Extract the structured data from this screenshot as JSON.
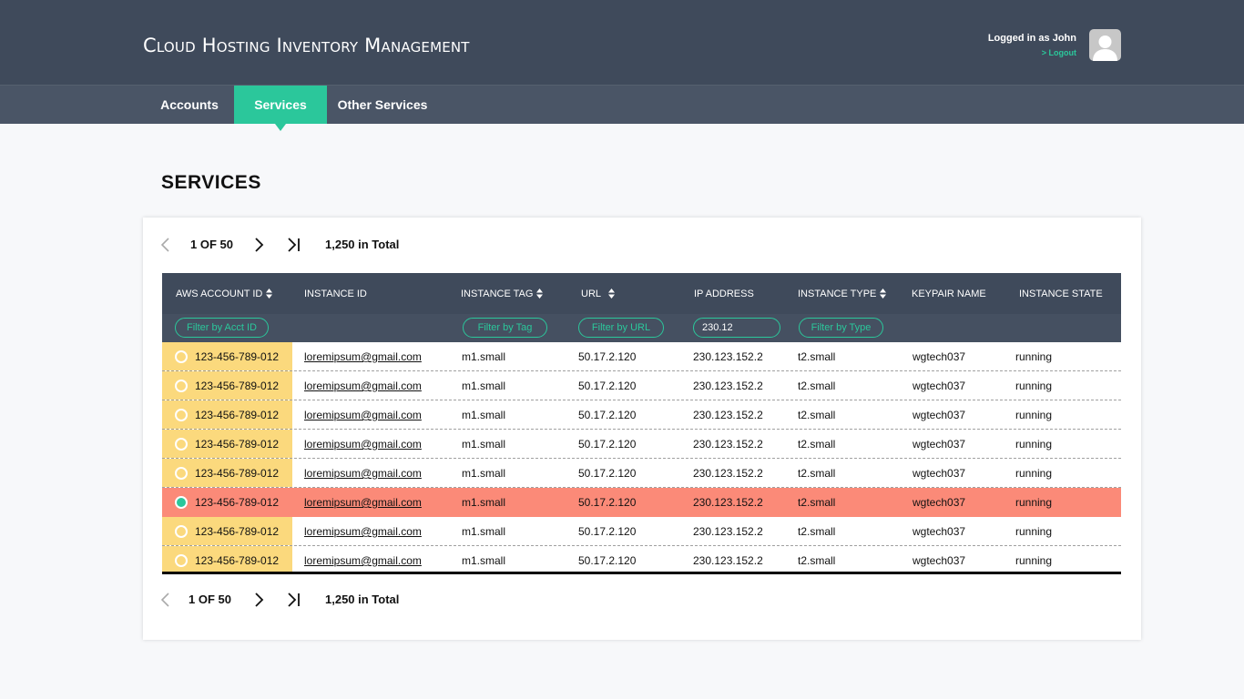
{
  "header": {
    "title": "Cloud Hosting Inventory Management",
    "logged_in": "Logged in as John",
    "logout": "> Logout"
  },
  "nav": {
    "tabs": [
      {
        "label": "Accounts",
        "active": false
      },
      {
        "label": "Services",
        "active": true
      },
      {
        "label": "Other Services",
        "active": false
      }
    ]
  },
  "page_title": "SERVICES",
  "pager": {
    "top_label": "1 OF 50",
    "bottom_label": "1 OF 50",
    "total": "1,250 in Total"
  },
  "table": {
    "columns": [
      {
        "label": "AWS ACCOUNT ID",
        "sortable": true
      },
      {
        "label": "INSTANCE ID",
        "sortable": false
      },
      {
        "label": "INSTANCE TAG",
        "sortable": true
      },
      {
        "label": "URL",
        "sortable": true
      },
      {
        "label": "IP ADDRESS",
        "sortable": false
      },
      {
        "label": "INSTANCE TYPE",
        "sortable": true
      },
      {
        "label": "KEYPAIR NAME",
        "sortable": false
      },
      {
        "label": "INSTANCE STATE",
        "sortable": false
      }
    ],
    "filters": {
      "acct_placeholder": "Filter by Acct ID",
      "tag_placeholder": "Filter by Tag",
      "url_placeholder": "Filter by URL",
      "ip_value": "230.12",
      "type_placeholder": "Filter by Type"
    },
    "rows": [
      {
        "account": "123-456-789-012",
        "instance": "loremipsum@gmail.com",
        "tag": "m1.small",
        "url": "50.17.2.120",
        "ip": "230.123.152.2",
        "type": "t2.small",
        "keypair": "wgtech037",
        "state": "running",
        "selected": false
      },
      {
        "account": "123-456-789-012",
        "instance": "loremipsum@gmail.com",
        "tag": "m1.small",
        "url": "50.17.2.120",
        "ip": "230.123.152.2",
        "type": "t2.small",
        "keypair": "wgtech037",
        "state": "running",
        "selected": false
      },
      {
        "account": "123-456-789-012",
        "instance": "loremipsum@gmail.com",
        "tag": "m1.small",
        "url": "50.17.2.120",
        "ip": "230.123.152.2",
        "type": "t2.small",
        "keypair": "wgtech037",
        "state": "running",
        "selected": false
      },
      {
        "account": "123-456-789-012",
        "instance": "loremipsum@gmail.com",
        "tag": "m1.small",
        "url": "50.17.2.120",
        "ip": "230.123.152.2",
        "type": "t2.small",
        "keypair": "wgtech037",
        "state": "running",
        "selected": false
      },
      {
        "account": "123-456-789-012",
        "instance": "loremipsum@gmail.com",
        "tag": "m1.small",
        "url": "50.17.2.120",
        "ip": "230.123.152.2",
        "type": "t2.small",
        "keypair": "wgtech037",
        "state": "running",
        "selected": false
      },
      {
        "account": "123-456-789-012",
        "instance": "loremipsum@gmail.com",
        "tag": "m1.small",
        "url": "50.17.2.120",
        "ip": "230.123.152.2",
        "type": "t2.small",
        "keypair": "wgtech037",
        "state": "running",
        "selected": true
      },
      {
        "account": "123-456-789-012",
        "instance": "loremipsum@gmail.com",
        "tag": "m1.small",
        "url": "50.17.2.120",
        "ip": "230.123.152.2",
        "type": "t2.small",
        "keypair": "wgtech037",
        "state": "running",
        "selected": false
      },
      {
        "account": "123-456-789-012",
        "instance": "loremipsum@gmail.com",
        "tag": "m1.small",
        "url": "50.17.2.120",
        "ip": "230.123.152.2",
        "type": "t2.small",
        "keypair": "wgtech037",
        "state": "running",
        "selected": false
      }
    ]
  },
  "icons": {
    "prev": "chevron-left-icon",
    "next": "chevron-right-icon",
    "last": "last-page-icon",
    "sort": "sort-icon",
    "avatar": "user-avatar-icon"
  },
  "colors": {
    "header_bg": "#3f4a5b",
    "accent": "#2bc79b",
    "selected_row": "#fb8a78",
    "id_column": "#fbd97d"
  }
}
